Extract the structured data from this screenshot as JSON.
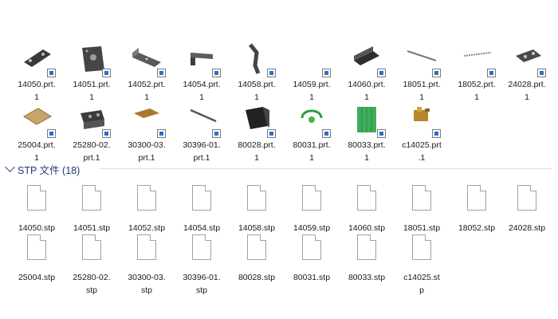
{
  "group_prt": {
    "items": [
      {
        "label": "14050.prt.\n1",
        "icon": "flat-bracket-icon"
      },
      {
        "label": "14051.prt.\n1",
        "icon": "plate-with-holes-icon"
      },
      {
        "label": "14052.prt.\n1",
        "icon": "angle-bracket-icon"
      },
      {
        "label": "14054.prt.\n1",
        "icon": "l-bracket-icon"
      },
      {
        "label": "14058.prt.\n1",
        "icon": "bent-arm-icon"
      },
      {
        "label": "14059.prt.\n1",
        "icon": "blank-part-icon"
      },
      {
        "label": "14060.prt.\n1",
        "icon": "channel-bracket-icon"
      },
      {
        "label": "18051.prt.\n1",
        "icon": "rod-icon"
      },
      {
        "label": "18052.prt.\n1",
        "icon": "threaded-rod-icon"
      },
      {
        "label": "24028.prt.\n1",
        "icon": "slotted-plate-icon"
      },
      {
        "label": "25004.prt.\n1",
        "icon": "tan-sheet-icon"
      },
      {
        "label": "25280-02.\nprt.1",
        "icon": "block-icon"
      },
      {
        "label": "30300-03.\nprt.1",
        "icon": "wood-board-icon"
      },
      {
        "label": "30396-01.\nprt.1",
        "icon": "pin-icon"
      },
      {
        "label": "80028.prt.\n1",
        "icon": "dark-block-icon"
      },
      {
        "label": "80031.prt.\n1",
        "icon": "green-clip-icon"
      },
      {
        "label": "80033.prt.\n1",
        "icon": "green-panel-icon"
      },
      {
        "label": "c14025.prt\n.1",
        "icon": "brass-fitting-icon"
      }
    ]
  },
  "group_stp": {
    "header": "STP 文件 (18)",
    "items": [
      {
        "label": "14050.stp"
      },
      {
        "label": "14051.stp"
      },
      {
        "label": "14052.stp"
      },
      {
        "label": "14054.stp"
      },
      {
        "label": "14058.stp"
      },
      {
        "label": "14059.stp"
      },
      {
        "label": "14060.stp"
      },
      {
        "label": "18051.stp"
      },
      {
        "label": "18052.stp"
      },
      {
        "label": "24028.stp"
      },
      {
        "label": "25004.stp"
      },
      {
        "label": "25280-02.\nstp"
      },
      {
        "label": "30300-03.\nstp"
      },
      {
        "label": "30396-01.\nstp"
      },
      {
        "label": "80028.stp"
      },
      {
        "label": "80031.stp"
      },
      {
        "label": "80033.stp"
      },
      {
        "label": "c14025.st\np"
      }
    ]
  },
  "colors": {
    "header_text": "#1e3a6e",
    "badge_blue": "#2a6fc9"
  }
}
